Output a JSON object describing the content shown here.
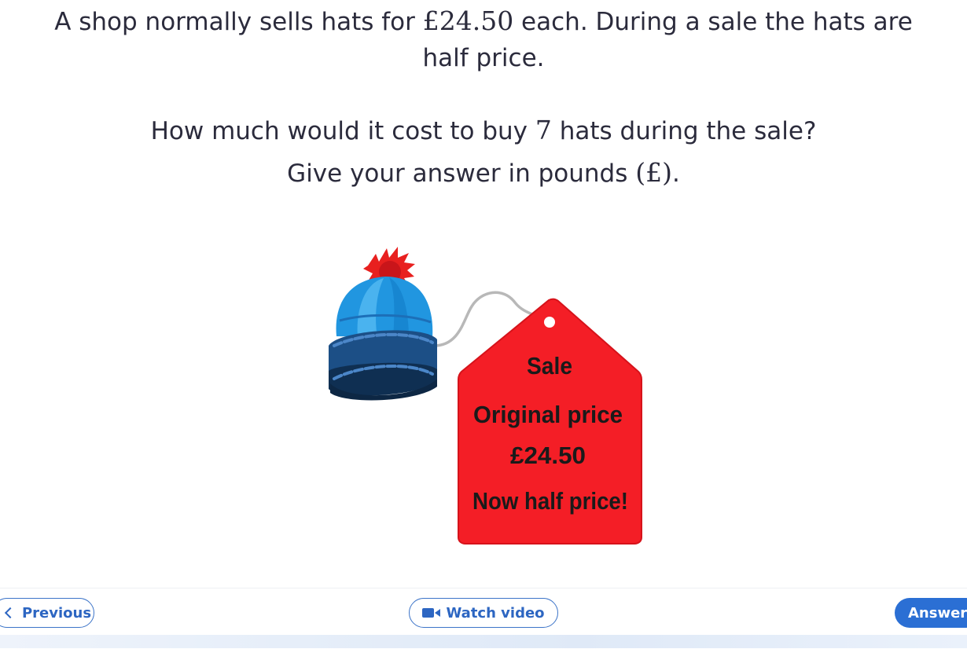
{
  "question": {
    "line1_pre": "A shop normally sells hats for ",
    "line1_price": "£24.50",
    "line1_post": " each. During a sale the hats are",
    "line2": "half price.",
    "line3_pre": "How much would it cost to buy ",
    "line3_num": "7",
    "line3_post": " hats during the sale?",
    "line4_pre": "Give your answer in pounds ",
    "line4_unit": "(£)",
    "line4_post": "."
  },
  "tag": {
    "line1": "Sale",
    "line2": "Original price",
    "line3": "£24.50",
    "line4": "Now half price!"
  },
  "nav": {
    "previous": "Previous",
    "watch_video": "Watch video",
    "answer": "Answer"
  },
  "colors": {
    "tag_red": "#f41e26",
    "hat_blue": "#2196e0",
    "hat_band": "#1c4f86",
    "pompom": "#e8201f",
    "button_blue": "#2b6fd4"
  }
}
